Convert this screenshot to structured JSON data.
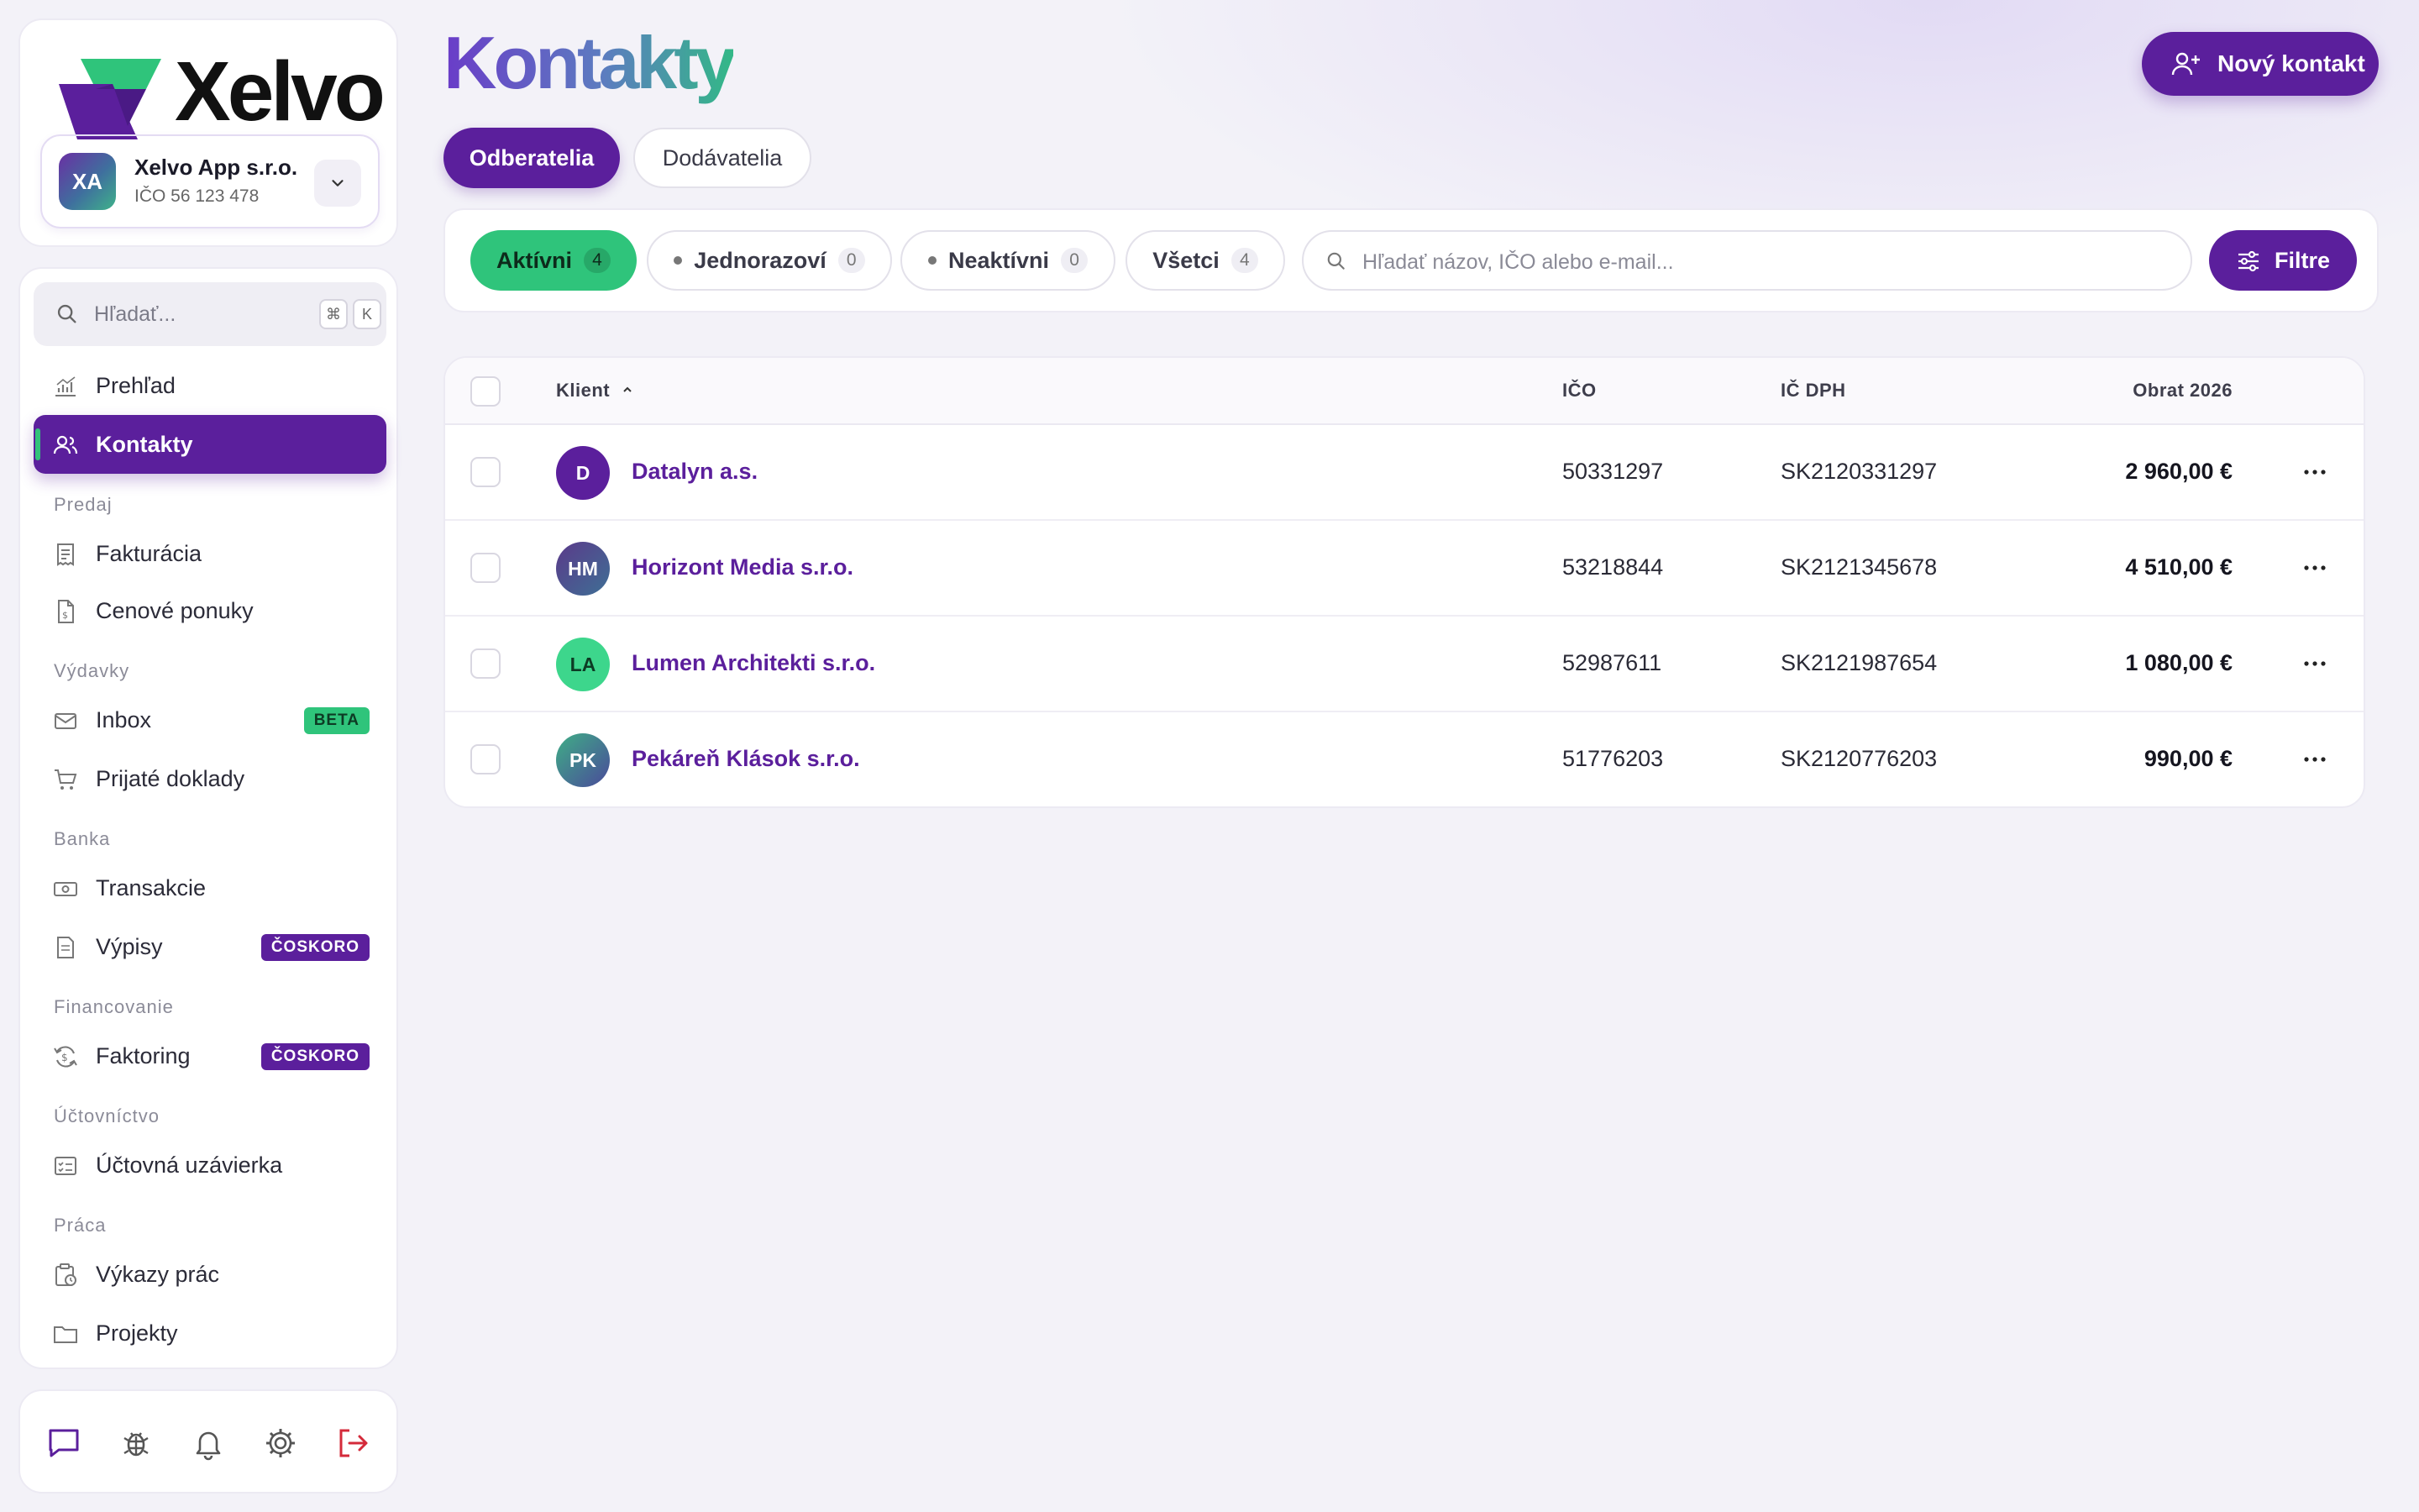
{
  "brand": {
    "name": "Xelvo"
  },
  "company": {
    "initials": "XA",
    "name": "Xelvo App s.r.o.",
    "ico": "IČO 56 123 478"
  },
  "sidebar": {
    "search_placeholder": "Hľadať...",
    "shortcut": [
      "⌘",
      "K"
    ],
    "items": [
      {
        "label": "Prehľad",
        "icon": "chart-icon"
      },
      {
        "label": "Kontakty",
        "icon": "users-icon",
        "active": true
      }
    ],
    "sections": [
      {
        "label": "Predaj",
        "items": [
          {
            "label": "Fakturácia"
          },
          {
            "label": "Cenové ponuky"
          }
        ]
      },
      {
        "label": "Výdavky",
        "items": [
          {
            "label": "Inbox",
            "badge": "BETA"
          },
          {
            "label": "Prijaté doklady"
          }
        ]
      },
      {
        "label": "Banka",
        "items": [
          {
            "label": "Transakcie"
          },
          {
            "label": "Výpisy",
            "badge": "ČOSKORO"
          }
        ]
      },
      {
        "label": "Financovanie",
        "items": [
          {
            "label": "Faktoring",
            "badge": "ČOSKORO"
          }
        ]
      },
      {
        "label": "Účtovníctvo",
        "items": [
          {
            "label": "Účtovná uzávierka"
          }
        ]
      },
      {
        "label": "Práca",
        "items": [
          {
            "label": "Výkazy prác"
          },
          {
            "label": "Projekty"
          }
        ]
      }
    ],
    "bottom_icons": [
      "chat-icon",
      "bug-icon",
      "bell-icon",
      "settings-icon",
      "logout-icon"
    ]
  },
  "page": {
    "title": "Kontakty",
    "new_button": "Nový kontakt",
    "segments": [
      {
        "label": "Odberatelia",
        "active": true
      },
      {
        "label": "Dodávatelia",
        "active": false
      }
    ],
    "chips": [
      {
        "label": "Aktívni",
        "count": "4",
        "active": true
      },
      {
        "label": "Jednorazoví",
        "count": "0"
      },
      {
        "label": "Neaktívni",
        "count": "0"
      },
      {
        "label": "Všetci",
        "count": "4"
      }
    ],
    "search_placeholder": "Hľadať názov, IČO alebo e-mail...",
    "filter_button": "Filtre"
  },
  "table": {
    "columns": {
      "client": "Klient",
      "ico": "IČO",
      "dic": "IČ DPH",
      "turnover": "Obrat 2026"
    },
    "rows": [
      {
        "initials": "D",
        "name": "Datalyn a.s.",
        "ico": "50331297",
        "dic": "SK2120331297",
        "turnover": "2 960,00 €"
      },
      {
        "initials": "HM",
        "name": "Horizont Media s.r.o.",
        "ico": "53218844",
        "dic": "SK2121345678",
        "turnover": "4 510,00 €"
      },
      {
        "initials": "LA",
        "name": "Lumen Architekti s.r.o.",
        "ico": "52987611",
        "dic": "SK2121987654",
        "turnover": "1 080,00 €"
      },
      {
        "initials": "PK",
        "name": "Pekáreň Klások s.r.o.",
        "ico": "51776203",
        "dic": "SK2120776203",
        "turnover": "990,00 €"
      }
    ]
  },
  "colors": {
    "accent": "#5b1f9c",
    "success": "#2fc47b",
    "danger": "#d42a3a"
  }
}
